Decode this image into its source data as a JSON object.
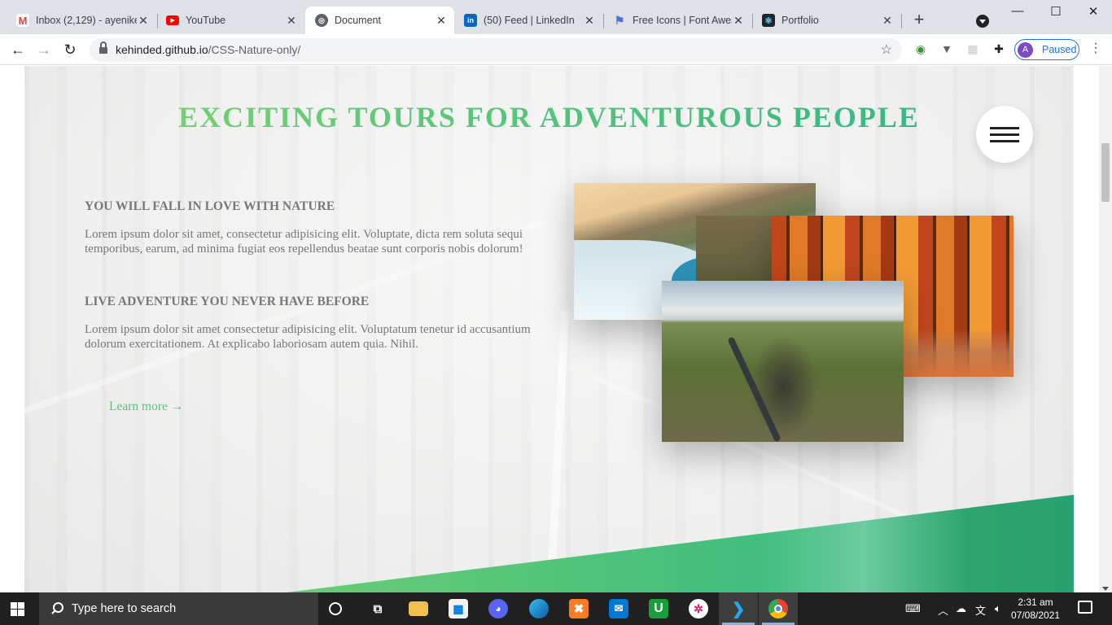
{
  "browser": {
    "tabs": [
      {
        "title": "Inbox (2,129) - ayenike",
        "icon": "gmail-icon",
        "color": "#ea4335"
      },
      {
        "title": "YouTube",
        "icon": "youtube-icon",
        "color": "#ff0000"
      },
      {
        "title": "Document",
        "icon": "globe-icon",
        "color": "#5f6368"
      },
      {
        "title": "(50) Feed | LinkedIn",
        "icon": "linkedin-icon",
        "color": "#0a66c2"
      },
      {
        "title": "Free Icons | Font Awes",
        "icon": "flag-icon",
        "color": "#4a6ee0"
      },
      {
        "title": "Portfolio",
        "icon": "react-icon",
        "color": "#20232a"
      }
    ],
    "url_domain": "kehinded.github.io",
    "url_path": "/CSS-Nature-only/",
    "profile_initial": "A",
    "profile_status": "Paused"
  },
  "page": {
    "heading": "EXCITING TOURS FOR ADVENTUROUS PEOPLE",
    "section1_title": "YOU WILL FALL IN LOVE WITH NATURE",
    "section1_text": "Lorem ipsum dolor sit amet, consectetur adipisicing elit. Voluptate, dicta rem soluta sequi temporibus, earum, ad minima fugiat eos repellendus beatae sunt corporis nobis dolorum!",
    "section2_title": "LIVE ADVENTURE YOU NEVER HAVE BEFORE",
    "section2_text": "Lorem ipsum dolor sit amet consectetur adipisicing elit. Voluptatum tenetur id accusantium dolorum exercitationem. At explicabo laboriosam autem quia. Nihil.",
    "learn_more": "Learn more →",
    "accent_colors": [
      "#7ed56f",
      "#28b485"
    ]
  },
  "taskbar": {
    "search_placeholder": "Type here to search",
    "time": "2:31 am",
    "date": "07/08/2021"
  }
}
